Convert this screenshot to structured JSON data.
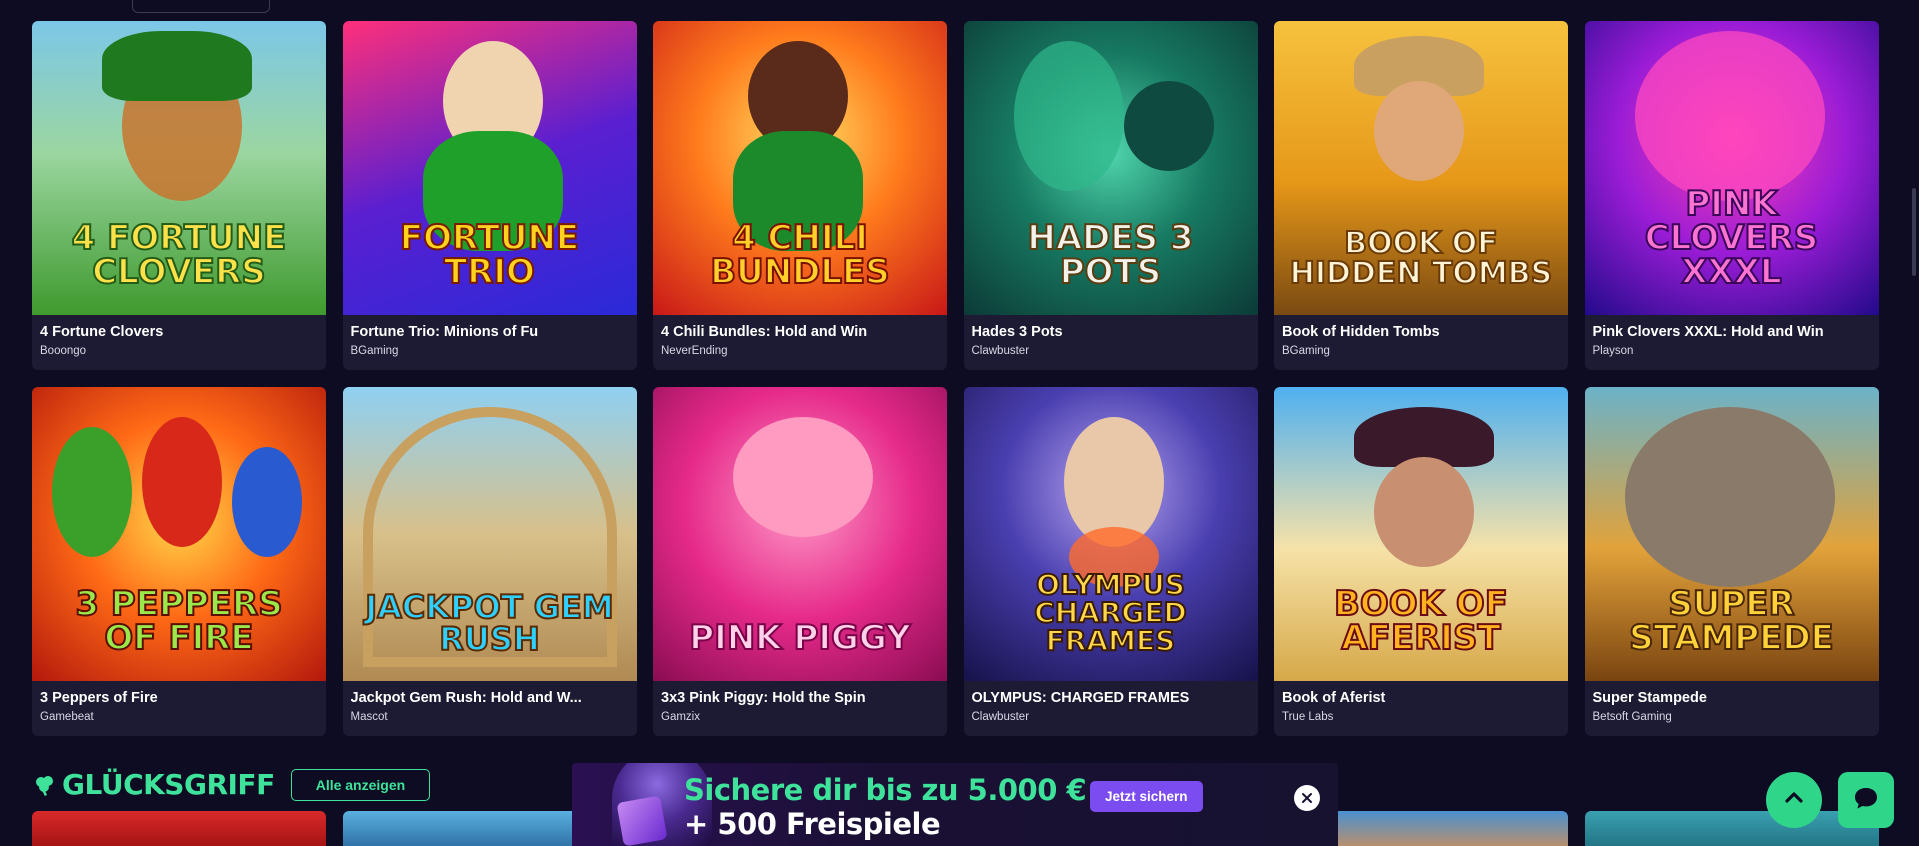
{
  "games": [
    {
      "name": "4 Fortune Clovers",
      "provider": "Booongo",
      "art_title": "4 Fortune Clovers"
    },
    {
      "name": "Fortune Trio: Minions of Fu",
      "provider": "BGaming",
      "art_title": "Fortune Trio"
    },
    {
      "name": "4 Chili Bundles: Hold and Win",
      "provider": "NeverEnding",
      "art_title": "4 Chili Bundles"
    },
    {
      "name": "Hades 3 Pots",
      "provider": "Clawbuster",
      "art_title": "Hades 3 Pots"
    },
    {
      "name": "Book of Hidden Tombs",
      "provider": "BGaming",
      "art_title": "Book of Hidden Tombs"
    },
    {
      "name": "Pink Clovers XXXL: Hold and Win",
      "provider": "Playson",
      "art_title": "Pink Clovers XXXL"
    },
    {
      "name": "3 Peppers of Fire",
      "provider": "Gamebeat",
      "art_title": "3 Peppers of Fire"
    },
    {
      "name": "Jackpot Gem Rush: Hold and W...",
      "provider": "Mascot",
      "art_title": "Jackpot Gem Rush"
    },
    {
      "name": "3x3 Pink Piggy: Hold the Spin",
      "provider": "Gamzix",
      "art_title": "Pink Piggy"
    },
    {
      "name": "OLYMPUS: CHARGED FRAMES",
      "provider": "Clawbuster",
      "art_title": "Olympus Charged Frames"
    },
    {
      "name": "Book of Aferist",
      "provider": "True Labs",
      "art_title": "Book of Aferist"
    },
    {
      "name": "Super Stampede",
      "provider": "Betsoft Gaming",
      "art_title": "Super Stampede"
    }
  ],
  "section": {
    "title": "GLÜCKSGRIFF",
    "show_all_label": "Alle anzeigen",
    "icon": "clover-icon"
  },
  "promo": {
    "line1": "Sichere dir bis zu 5.000 €",
    "line2": "+ 500 Freispiele",
    "button_label": "Jetzt sichern",
    "close_icon": "close-icon"
  },
  "floating": {
    "scroll_top_icon": "chevron-up-icon",
    "chat_icon": "chat-bubble-icon"
  },
  "colors": {
    "background": "#0d0c22",
    "card": "#1c1b33",
    "accent_green": "#3ee29a",
    "button_purple": "#7b4cf0"
  }
}
